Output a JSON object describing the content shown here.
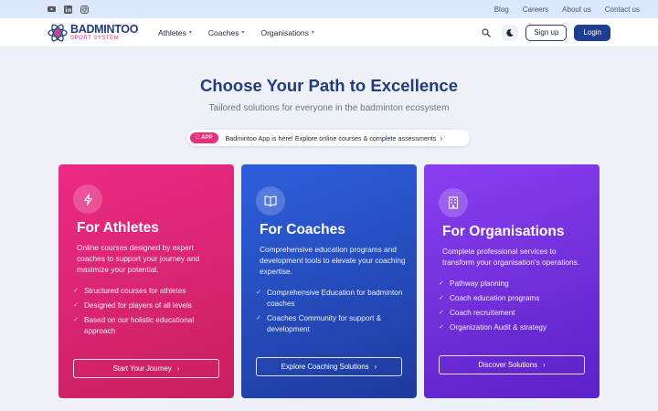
{
  "topbar": {
    "social": [
      {
        "icon": "youtube-icon"
      },
      {
        "icon": "linkedin-icon"
      },
      {
        "icon": "instagram-icon"
      }
    ],
    "links": [
      "Blog",
      "Careers",
      "About us",
      "Contact us"
    ]
  },
  "nav": {
    "logo_main": "BADMINTOO",
    "logo_sub": "SPORT SYSTEM",
    "menu": [
      "Athletes",
      "Coaches",
      "Organisations"
    ],
    "signup_label": "Sign up",
    "login_label": "Login"
  },
  "hero": {
    "title": "Choose Your Path to Excellence",
    "subtitle": "Tailored solutions for everyone in the badminton ecosystem",
    "pill_badge": " APP",
    "pill_text": "Badmintoo App is here! Explore online courses & complete assessments"
  },
  "cards": [
    {
      "icon": "lightning-icon",
      "title": "For Athletes",
      "description": "Online courses designed by expert coaches to support your journey and maximize your potential.",
      "features": [
        "Structured courses for athletes",
        "Designed for players of all levels",
        "Based on our holistic educational approach"
      ],
      "button": "Start Your Journey"
    },
    {
      "icon": "book-icon",
      "title": "For Coaches",
      "description": "Comprehensive education programs and development tools to elevate your coaching expertise.",
      "features": [
        "Comprehensive Education for badminton coaches",
        "Coaches Community for support & development"
      ],
      "button": "Explore Coaching Solutions"
    },
    {
      "icon": "building-icon",
      "title": "For Organisations",
      "description": "Complete professional services to transform your organisation's operations.",
      "features": [
        "Pathway planning",
        "Coach education programs",
        "Coach recruitement",
        "Organization Audit & strategy"
      ],
      "button": "Discover Solutions"
    }
  ],
  "colors": {
    "brand": "#233b7a",
    "accent_pink": "#e8317b",
    "athletes": "#e0276f",
    "coaches": "#2652c8",
    "organisations": "#7431e0"
  }
}
